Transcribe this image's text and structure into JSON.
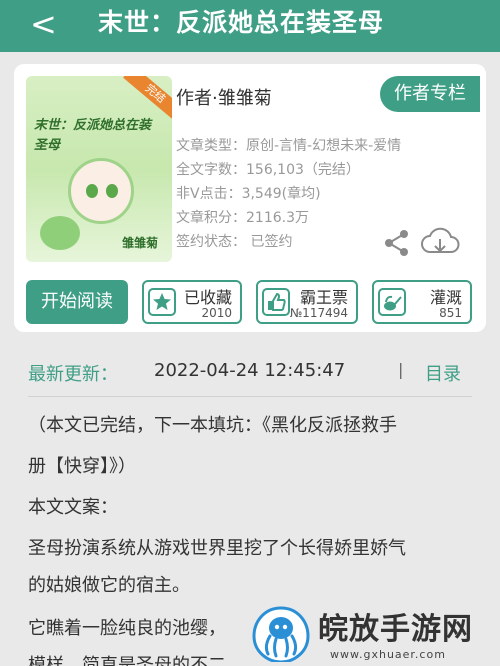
{
  "header": {
    "back_glyph": "<",
    "title": "末世：反派她总在装圣母"
  },
  "cover": {
    "badge": "完结",
    "title": "末世：反派她总在装圣母",
    "author": "雏雏菊",
    "colors": {
      "bg": "#cfeebb",
      "accent": "#2f6f2b"
    }
  },
  "book": {
    "author_label": "作者·雏雏菊",
    "author_button": "作者专栏",
    "meta": [
      "文章类型：原创-言情-幻想未来-爱情",
      "全文字数：156,103（完结）",
      "非V点击：3,549(章均)",
      "文章积分：2116.3万",
      "签约状态：  已签约"
    ],
    "icons": {
      "share": "share-icon",
      "download": "cloud-download-icon"
    }
  },
  "actions": {
    "read": "开始阅读",
    "collect": {
      "label": "已收藏",
      "count": "2010",
      "icon": "star-icon"
    },
    "ticket": {
      "label": "霸王票",
      "count": "№117494",
      "icon": "thumb-up-icon"
    },
    "water": {
      "label": "灌溉",
      "count": "851",
      "icon": "watering-can-icon"
    }
  },
  "update": {
    "label": "最新更新：",
    "datetime": "2022-04-24 12:45:47",
    "separator": "|",
    "toc": "目录"
  },
  "content": {
    "lines": [
      "（本文已完结，下一本填坑：《黑化反派拯救手",
      "册【快穿】》）",
      "本文文案：",
      "圣母扮演系统从游戏世界里挖了个长得娇里娇气",
      "的姑娘做它的宿主。",
      "它瞧着一脸纯良的池缨，",
      "模样，简直是圣母的不二"
    ]
  },
  "watermark": {
    "text": "皖放手游网",
    "url": "www.gxhuaer.com",
    "icon": "octopus-logo-icon"
  },
  "colors": {
    "brand": "#3f9f86",
    "badge": "#e9852f",
    "page_bg": "#e9e9e9"
  }
}
